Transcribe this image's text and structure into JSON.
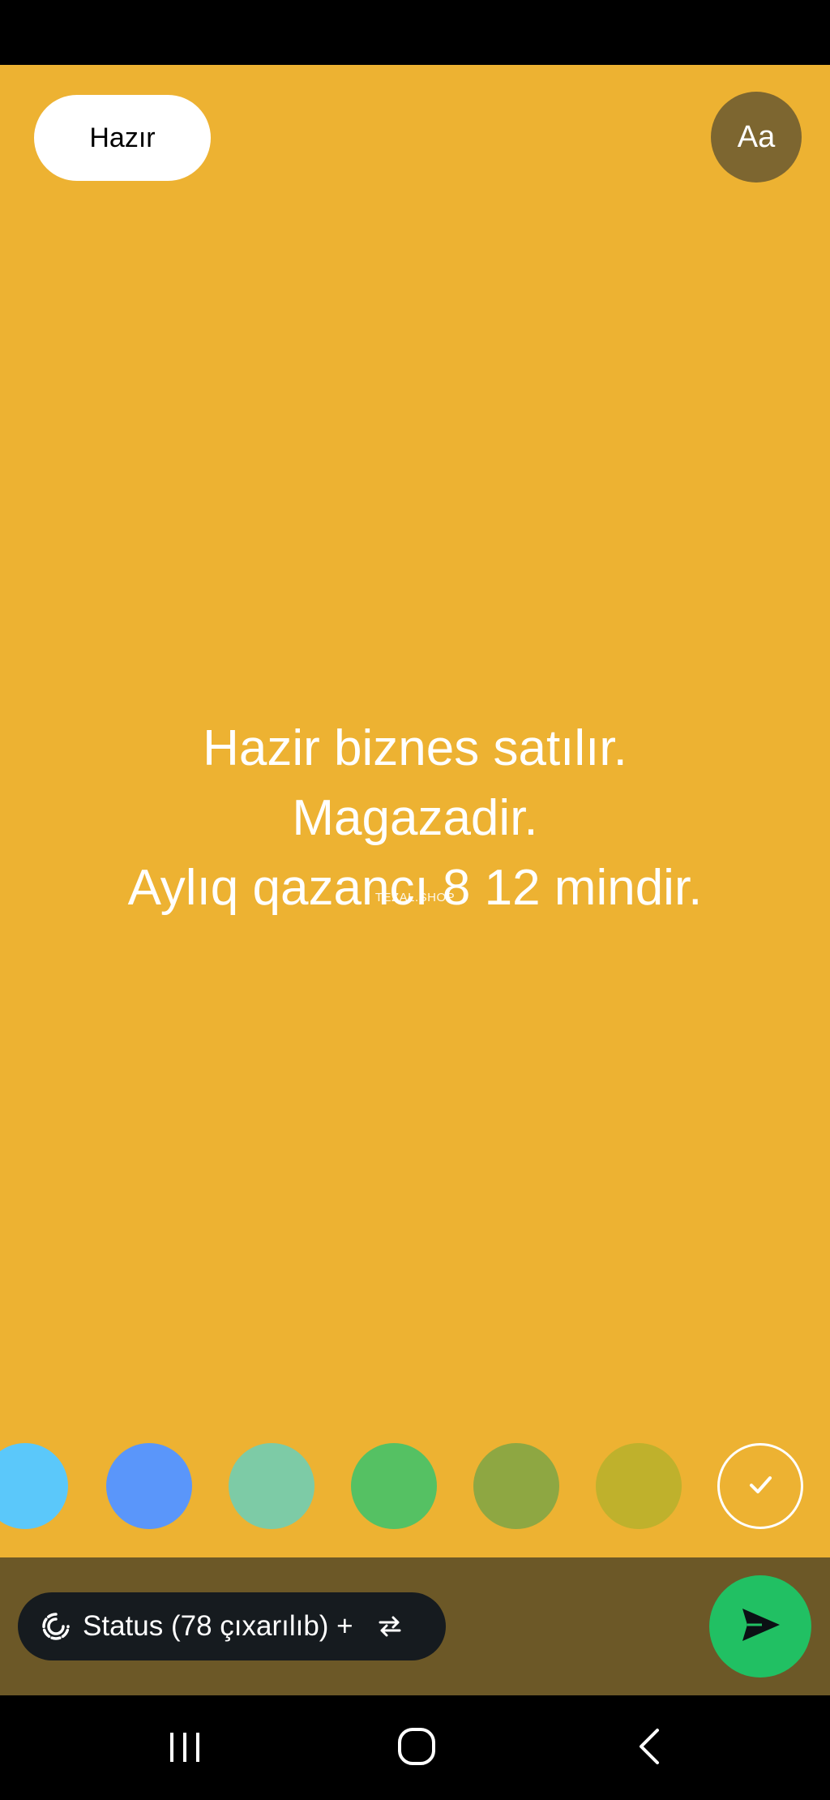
{
  "header": {
    "done_label": "Hazır",
    "font_label": "Aa"
  },
  "status": {
    "lines": [
      "Hazir biznes satılır.",
      "Magazadir.",
      "Aylıq qazancı 8 12 mindir."
    ],
    "watermark": "TEZAL.SHOP",
    "background_color": "#EDB232",
    "text_color": "#FFFFFF"
  },
  "color_palette": {
    "swatches": [
      {
        "color": "#5BC8FA"
      },
      {
        "color": "#5A96FA"
      },
      {
        "color": "#7DCBA6"
      },
      {
        "color": "#55C163"
      },
      {
        "color": "#8EA742"
      },
      {
        "color": "#BFB12C"
      }
    ],
    "selected_icon": "check-icon"
  },
  "footer": {
    "audience_label": "Status (78 çıxarılıb) +",
    "audience_icon": "status-ring-icon",
    "swap_icon": "swap-icon",
    "send_icon": "send-icon",
    "send_color": "#21C063"
  },
  "nav": {
    "recents_icon": "recents-icon",
    "home_icon": "home-icon",
    "back_icon": "back-icon"
  }
}
